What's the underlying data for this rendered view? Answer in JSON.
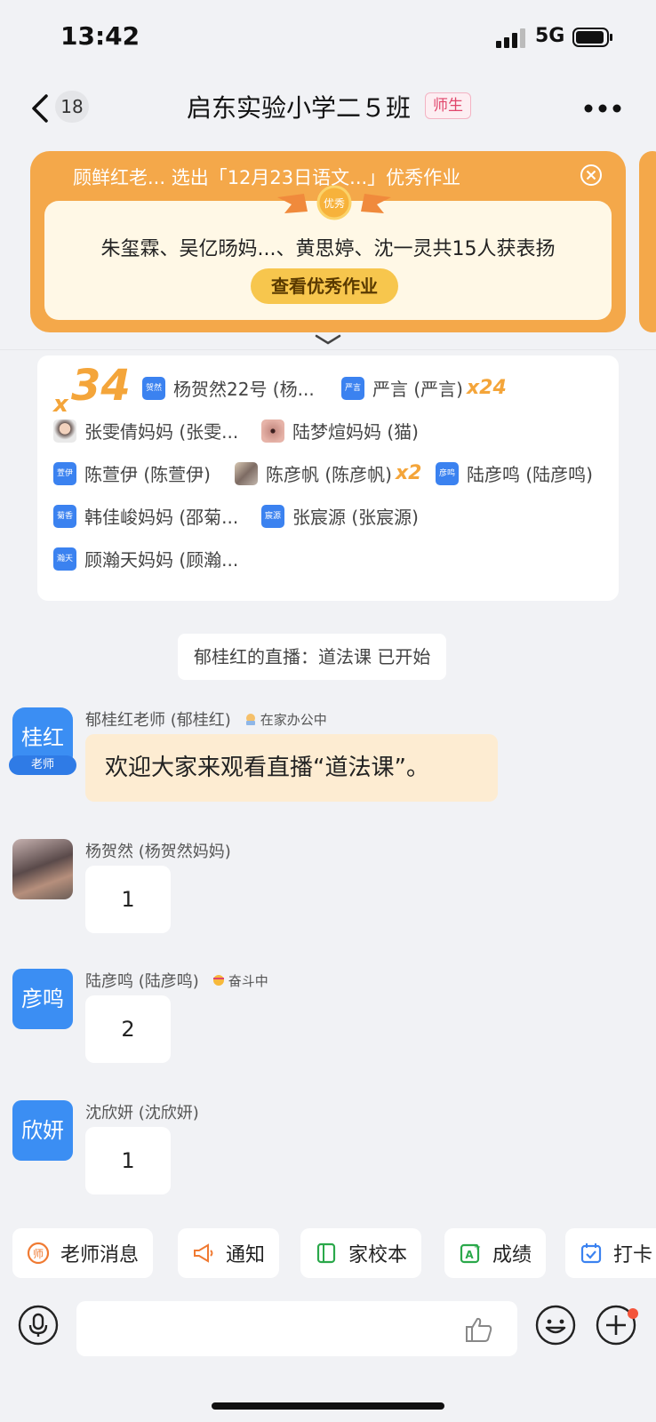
{
  "status_bar": {
    "time": "13:42",
    "network": "5G"
  },
  "nav": {
    "unread_count": "18",
    "title": "启东实验小学二５班",
    "role_tag": "师生"
  },
  "banner": {
    "text": "顾鲜红老... 选出「12月23日语文...」优秀作业",
    "ribbon_label": "优秀",
    "praise_text": "朱玺霖、吴亿旸妈...、黄思婷、沈一灵共15人获表扬",
    "button_label": "查看优秀作业"
  },
  "likes_card": {
    "x_symbol": "x",
    "total": "34",
    "entries": [
      {
        "tag": "贺然",
        "name": "杨贺然22号 (杨...",
        "mult": "",
        "avatar": "tag"
      },
      {
        "tag": "严言",
        "name": "严言 (严言)",
        "mult": "x24",
        "avatar": "tag"
      },
      {
        "tag": "",
        "name": "张雯倩妈妈 (张雯...",
        "mult": "",
        "avatar": "photo"
      },
      {
        "tag": "",
        "name": "陆梦煊妈妈 (猫)",
        "mult": "",
        "avatar": "photo"
      },
      {
        "tag": "萱伊",
        "name": "陈萱伊 (陈萱伊)",
        "mult": "",
        "avatar": "tag"
      },
      {
        "tag": "",
        "name": "陈彦帆 (陈彦帆)",
        "mult": "x2",
        "avatar": "photo"
      },
      {
        "tag": "彦鸣",
        "name": "陆彦鸣 (陆彦鸣)",
        "mult": "",
        "avatar": "tag"
      },
      {
        "tag": "菊香",
        "name": "韩佳峻妈妈 (邵菊...",
        "mult": "",
        "avatar": "tag"
      },
      {
        "tag": "宸源",
        "name": "张宸源 (张宸源)",
        "mult": "",
        "avatar": "tag"
      },
      {
        "tag": "瀚天",
        "name": "顾瀚天妈妈 (顾瀚...",
        "mult": "",
        "avatar": "tag"
      }
    ]
  },
  "system_message": "郁桂红的直播：道法课 已开始",
  "messages": [
    {
      "avatar_text": "桂红",
      "avatar_sub": "老师",
      "sender": "郁桂红老师 (郁桂红)",
      "status": "在家办公中",
      "text": "欢迎大家来观看直播“道法课”。"
    },
    {
      "avatar_text": "",
      "sender": "杨贺然 (杨贺然妈妈)",
      "status": "",
      "text": "1"
    },
    {
      "avatar_text": "彦鸣",
      "sender": "陆彦鸣 (陆彦鸣)",
      "status": "奋斗中",
      "text": "2"
    },
    {
      "avatar_text": "欣妍",
      "sender": "沈欣妍 (沈欣妍)",
      "status": "",
      "text": "1"
    }
  ],
  "quick_actions": [
    {
      "label": "老师消息",
      "icon": "teacher-icon"
    },
    {
      "label": "通知",
      "icon": "megaphone-icon"
    },
    {
      "label": "家校本",
      "icon": "notebook-icon"
    },
    {
      "label": "成绩",
      "icon": "grade-icon"
    },
    {
      "label": "打卡",
      "icon": "checkin-icon"
    }
  ],
  "colors": {
    "accent": "#3b8ef3",
    "banner": "#f4a84a",
    "highlight": "#f4a53a"
  }
}
